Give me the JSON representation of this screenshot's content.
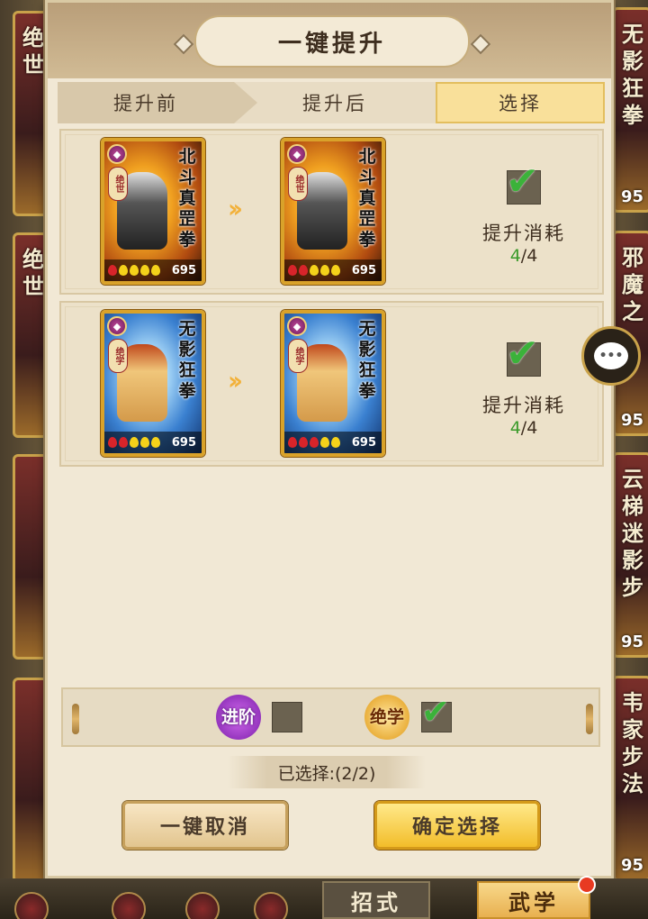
{
  "title": "一键提升",
  "tabs": [
    {
      "label": "提升前"
    },
    {
      "label": "提升后"
    },
    {
      "label": "选择"
    }
  ],
  "rows": [
    {
      "before": {
        "name": "北斗真罡拳",
        "badge": "绝世",
        "power": "695",
        "stars": [
          "red",
          "yellow",
          "yellow",
          "yellow",
          "yellow"
        ]
      },
      "after": {
        "name": "北斗真罡拳",
        "badge": "绝世",
        "power": "695",
        "stars": [
          "red",
          "red",
          "yellow",
          "yellow",
          "yellow"
        ]
      },
      "checked": true,
      "cost_label": "提升消耗",
      "cost_have": "4",
      "cost_need": "/4"
    },
    {
      "before": {
        "name": "无影狂拳",
        "badge": "绝学",
        "power": "695",
        "stars": [
          "red",
          "red",
          "yellow",
          "yellow",
          "yellow"
        ]
      },
      "after": {
        "name": "无影狂拳",
        "badge": "绝学",
        "power": "695",
        "stars": [
          "red",
          "red",
          "red",
          "yellow",
          "yellow"
        ]
      },
      "checked": true,
      "cost_label": "提升消耗",
      "cost_have": "4",
      "cost_need": "/4"
    }
  ],
  "filters": {
    "advance": {
      "label": "进阶",
      "checked": false
    },
    "ultimate": {
      "label": "绝学",
      "checked": true
    }
  },
  "selected_text": "已选择:(2/2)",
  "buttons": {
    "cancel": "一键取消",
    "confirm": "确定选择"
  },
  "bottom_tabs": {
    "moves": "招式",
    "martial": "武学"
  },
  "side_cards": {
    "left": [
      "绝世",
      "绝世",
      "",
      ""
    ],
    "right": [
      {
        "name": "无影狂拳",
        "power": "95"
      },
      {
        "name": "邪魔之",
        "power": "95"
      },
      {
        "name": "云梯迷影步",
        "power": "95"
      },
      {
        "name": "韦家步法",
        "power": "95"
      }
    ]
  },
  "colors": {
    "accent_gold": "#f2bd2a",
    "check_green": "#3bb23a",
    "cost_green": "#3a9a2a"
  }
}
